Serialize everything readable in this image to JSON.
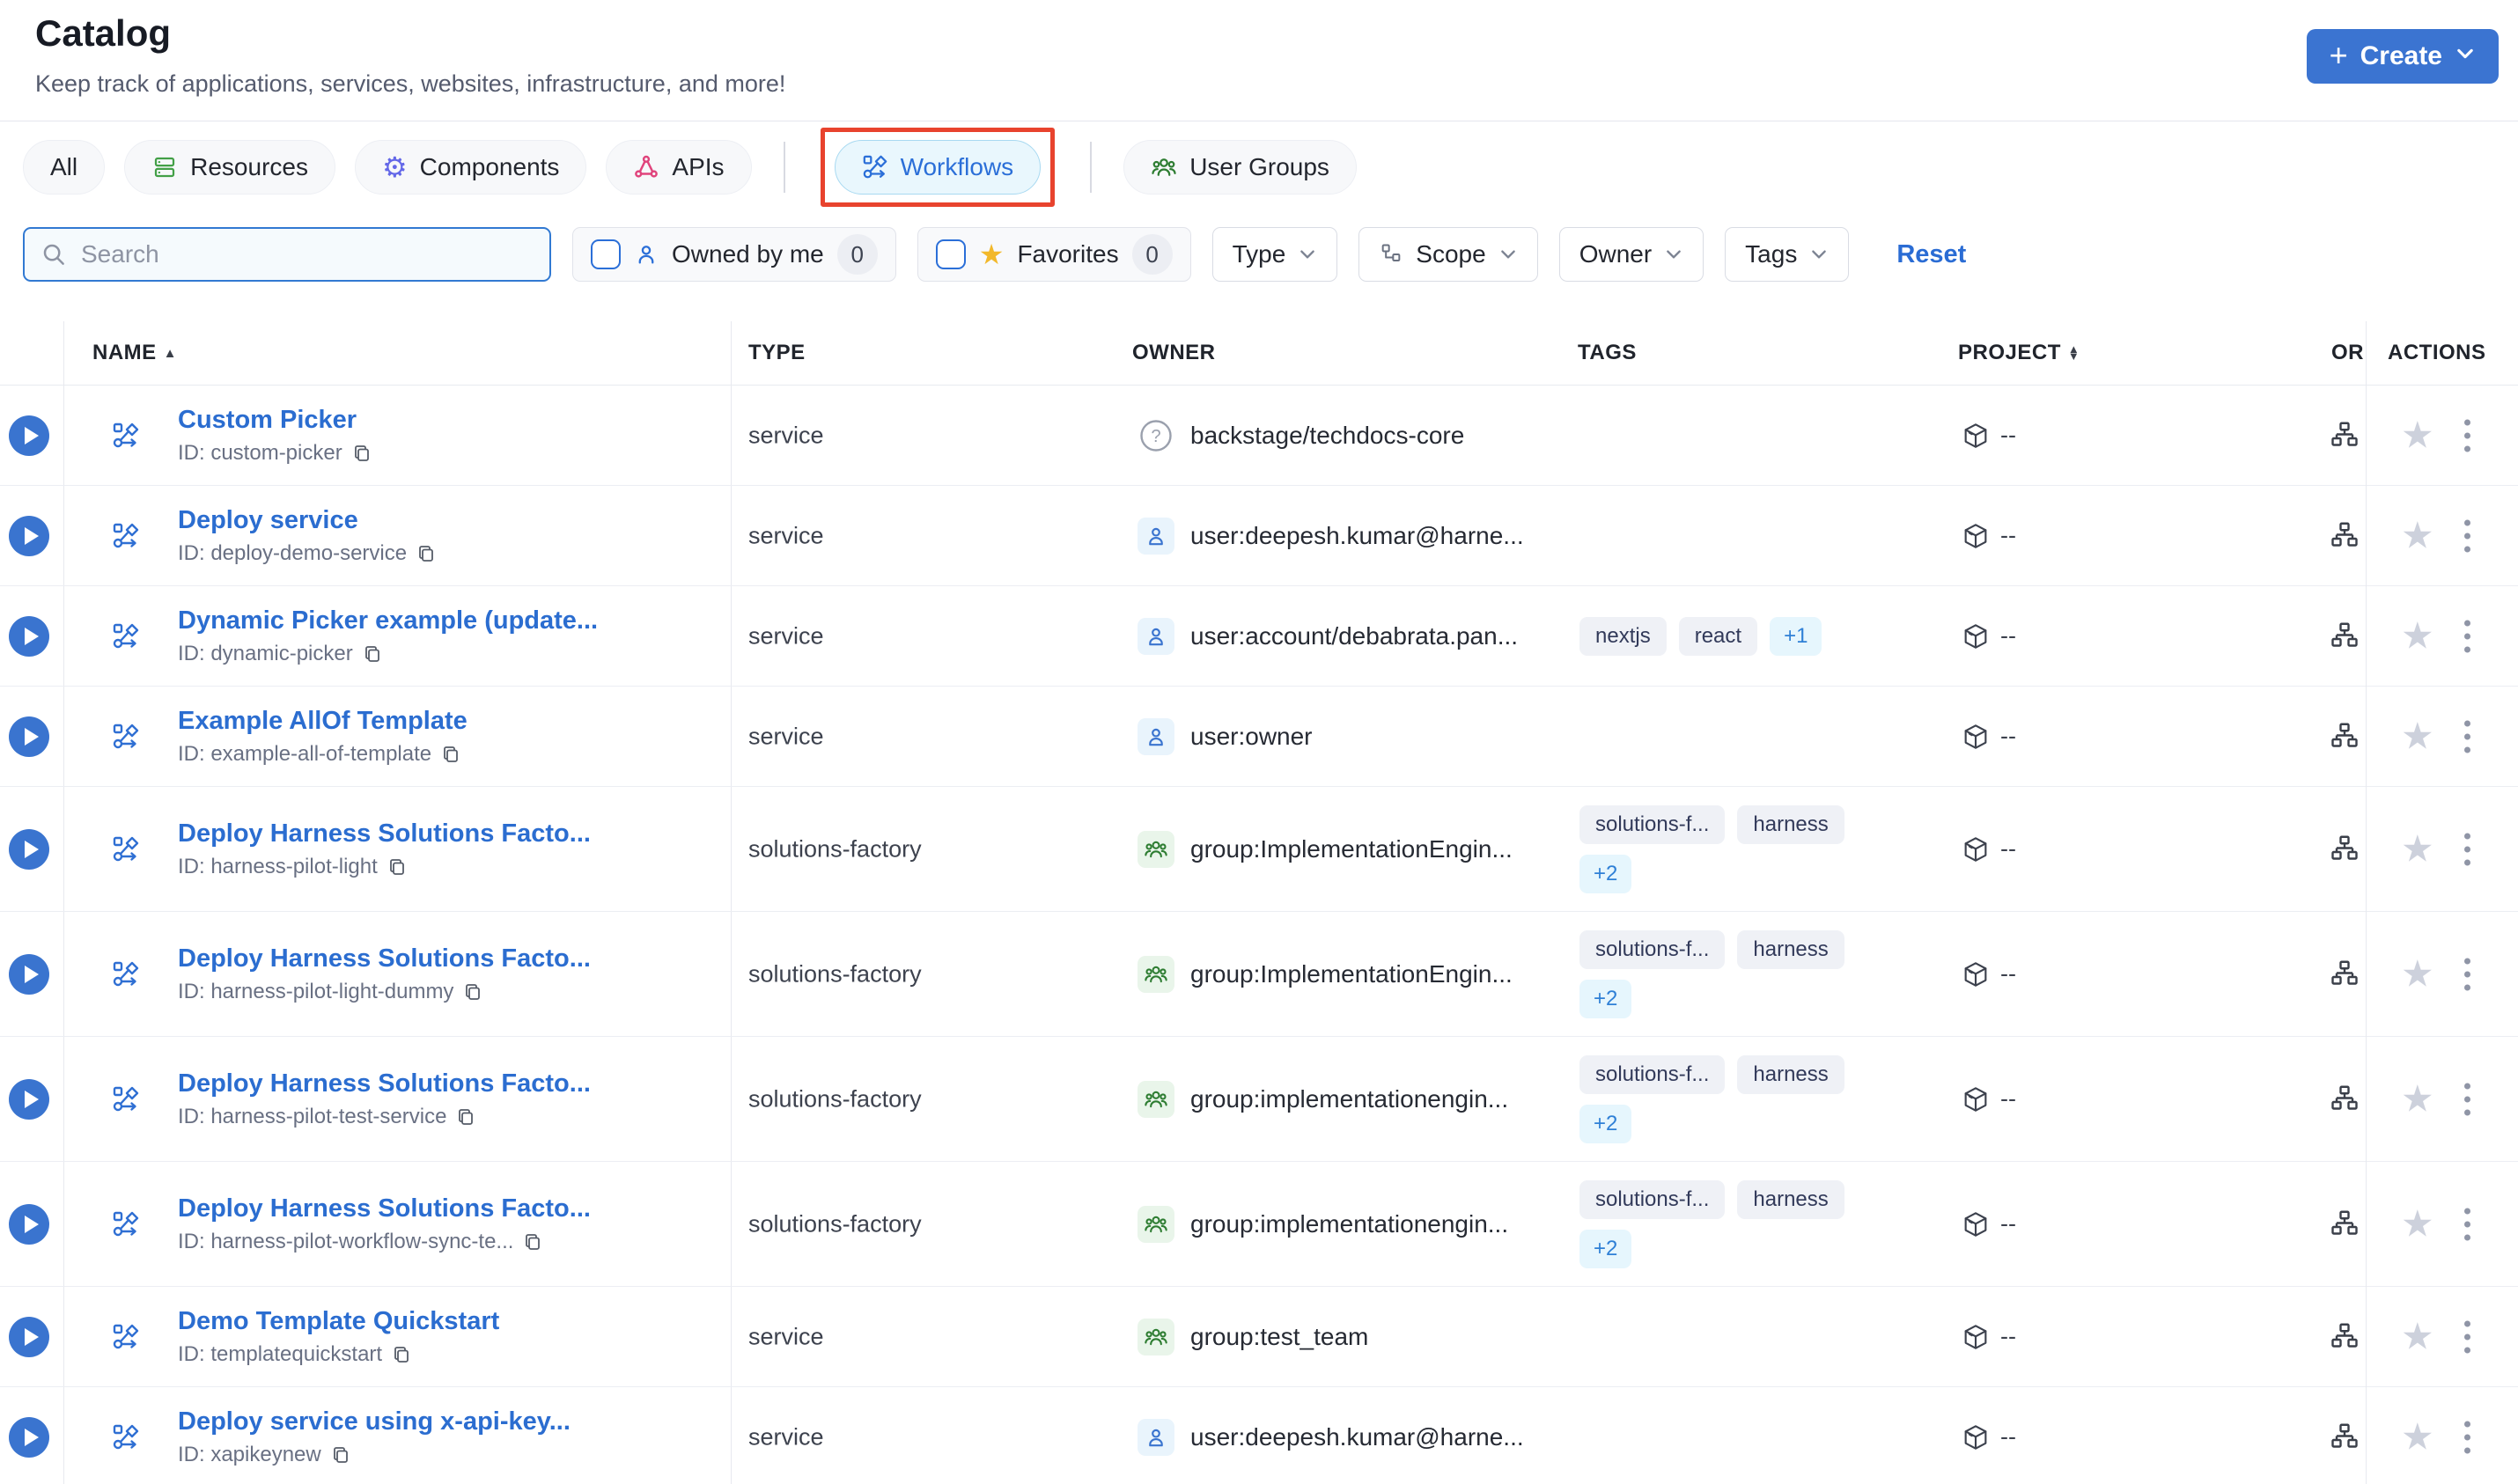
{
  "page": {
    "title": "Catalog",
    "subtitle": "Keep track of applications, services, websites, infrastructure, and more!"
  },
  "create_button": {
    "label": "Create"
  },
  "tabs": {
    "catalog": [
      {
        "label": "All"
      },
      {
        "label": "Resources"
      },
      {
        "label": "Components"
      },
      {
        "label": "APIs"
      }
    ],
    "workflows": {
      "label": "Workflows",
      "active": true,
      "annotated": true
    },
    "user_groups": {
      "label": "User Groups"
    }
  },
  "filters": {
    "search": {
      "placeholder": "Search",
      "value": ""
    },
    "owned_by_me": {
      "label": "Owned by me",
      "count": "0",
      "checked": false
    },
    "favorites": {
      "label": "Favorites",
      "count": "0",
      "checked": false
    },
    "dropdowns": [
      {
        "label": "Type"
      },
      {
        "label": "Scope"
      },
      {
        "label": "Owner"
      },
      {
        "label": "Tags"
      }
    ],
    "reset_label": "Reset"
  },
  "table": {
    "columns": {
      "name": "NAME",
      "type": "TYPE",
      "owner": "OWNER",
      "tags": "TAGS",
      "project": "PROJECT",
      "truncated": "OR",
      "actions": "ACTIONS"
    },
    "id_prefix": "ID: ",
    "rows": [
      {
        "name": "Custom Picker",
        "id": "custom-picker",
        "type": "service",
        "owner": {
          "kind": "unknown",
          "text": "backstage/techdocs-core"
        },
        "tags": [],
        "tags_more": "",
        "project": "--"
      },
      {
        "name": "Deploy service",
        "id": "deploy-demo-service",
        "type": "service",
        "owner": {
          "kind": "user",
          "text": "user:deepesh.kumar@harne..."
        },
        "tags": [],
        "tags_more": "",
        "project": "--"
      },
      {
        "name": "Dynamic Picker example (update...",
        "id": "dynamic-picker",
        "type": "service",
        "owner": {
          "kind": "user",
          "text": "user:account/debabrata.pan..."
        },
        "tags": [
          "nextjs",
          "react"
        ],
        "tags_more": "+1",
        "project": "--"
      },
      {
        "name": "Example AllOf Template",
        "id": "example-all-of-template",
        "type": "service",
        "owner": {
          "kind": "user",
          "text": "user:owner"
        },
        "tags": [],
        "tags_more": "",
        "project": "--"
      },
      {
        "name": "Deploy Harness Solutions Facto...",
        "id": "harness-pilot-light",
        "type": "solutions-factory",
        "owner": {
          "kind": "group",
          "text": "group:ImplementationEngin..."
        },
        "tags": [
          "solutions-f...",
          "harness"
        ],
        "tags_more": "+2",
        "two_line_tags": true,
        "project": "--"
      },
      {
        "name": "Deploy Harness Solutions Facto...",
        "id": "harness-pilot-light-dummy",
        "type": "solutions-factory",
        "owner": {
          "kind": "group",
          "text": "group:ImplementationEngin..."
        },
        "tags": [
          "solutions-f...",
          "harness"
        ],
        "tags_more": "+2",
        "two_line_tags": true,
        "project": "--"
      },
      {
        "name": "Deploy Harness Solutions Facto...",
        "id": "harness-pilot-test-service",
        "type": "solutions-factory",
        "owner": {
          "kind": "group",
          "text": "group:implementationengin..."
        },
        "tags": [
          "solutions-f...",
          "harness"
        ],
        "tags_more": "+2",
        "two_line_tags": true,
        "project": "--"
      },
      {
        "name": "Deploy Harness Solutions Facto...",
        "id": "harness-pilot-workflow-sync-te...",
        "type": "solutions-factory",
        "owner": {
          "kind": "group",
          "text": "group:implementationengin..."
        },
        "tags": [
          "solutions-f...",
          "harness"
        ],
        "tags_more": "+2",
        "two_line_tags": true,
        "project": "--"
      },
      {
        "name": "Demo Template Quickstart",
        "id": "templatequickstart",
        "type": "service",
        "owner": {
          "kind": "group",
          "text": "group:test_team"
        },
        "tags": [],
        "tags_more": "",
        "project": "--"
      },
      {
        "name": "Deploy service using x-api-key...",
        "id": "xapikeynew",
        "type": "service",
        "owner": {
          "kind": "user",
          "text": "user:deepesh.kumar@harne..."
        },
        "tags": [],
        "tags_more": "",
        "project": "--"
      }
    ]
  },
  "colors": {
    "primary_blue": "#2F6FD3",
    "create_button_blue": "#3B74D1",
    "annotation_red": "#E8432E",
    "favorites_star_yellow": "#F2B82A",
    "tag_more_blue": "#2F80D6",
    "resources_green": "#43A047",
    "components_indigo": "#6468E8",
    "apis_pink": "#E0447C",
    "groups_green": "#2E7D32"
  }
}
